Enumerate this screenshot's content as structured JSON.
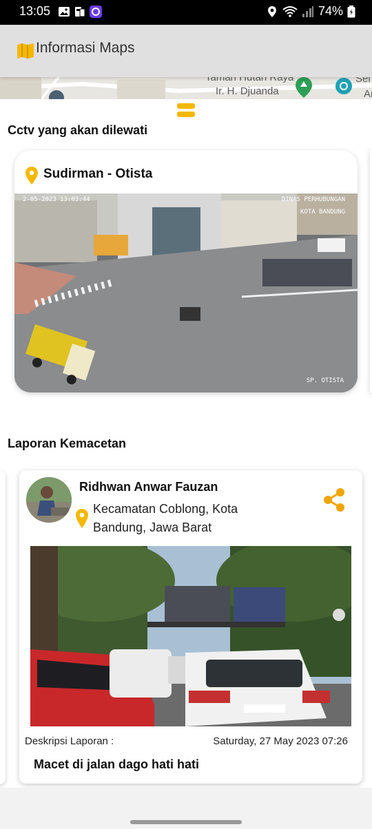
{
  "status_bar": {
    "time": "13:05",
    "battery": "74%",
    "icons_left": [
      "gallery-icon",
      "sim-icon",
      "app-notification-icon"
    ],
    "icons_right": [
      "location-icon",
      "wifi-icon",
      "signal-icon",
      "battery-icon"
    ]
  },
  "app_bar": {
    "title": "Informasi Maps",
    "icon": "map-icon"
  },
  "map": {
    "labels": [
      "Taman Hutan Raya",
      "Ir. H. Djuanda",
      "Sel",
      "Art"
    ]
  },
  "cctv_section": {
    "title": "Cctv yang akan dilewati",
    "cards": [
      {
        "name": "Sudirman - Otista",
        "overlay_timestamp": "2-05-2023 13:03:44",
        "overlay_dept": "DINAS PERHUBUNGAN",
        "overlay_city": "KOTA BANDUNG",
        "overlay_location": "SP. OTISTA"
      }
    ]
  },
  "reports_section": {
    "title": "Laporan Kemacetan",
    "cards": [
      {
        "reporter": "Ridhwan Anwar Fauzan",
        "location": "Kecamatan Coblong, Kota Bandung, Jawa Barat",
        "description_label": "Deskripsi Laporan :",
        "date": "Saturday, 27 May 2023 07:26",
        "description": "Macet di jalan dago hati hati"
      }
    ]
  },
  "colors": {
    "accent": "#f5b800",
    "share": "#f0a500"
  }
}
